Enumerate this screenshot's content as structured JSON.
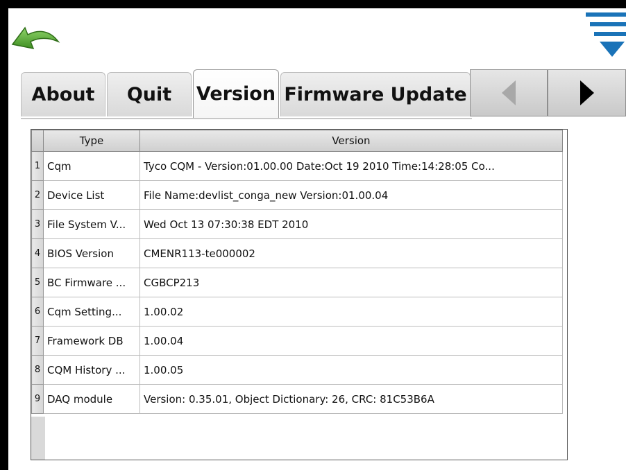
{
  "icons": {
    "back": "back-arrow-icon",
    "menu": "menu-triangle-icon",
    "prev": "left-triangle-icon",
    "next": "right-triangle-icon"
  },
  "colors": {
    "back_arrow": "#5aa832",
    "menu_blue": "#1a73b8",
    "frame": "#000000"
  },
  "tabs": [
    {
      "label": "About"
    },
    {
      "label": "Quit"
    },
    {
      "label": "Version",
      "active": true
    },
    {
      "label": "Firmware Update"
    }
  ],
  "table": {
    "columns": [
      "Type",
      "Version"
    ],
    "rows": [
      {
        "num": "1",
        "type": "Cqm",
        "version": "Tyco CQM -  Version:01.00.00 Date:Oct 19 2010  Time:14:28:05 Co..."
      },
      {
        "num": "2",
        "type": "Device List",
        "version": "File Name:devlist_conga_new Version:01.00.04"
      },
      {
        "num": "3",
        "type": "File System V...",
        "version": "Wed Oct 13 07:30:38 EDT 2010"
      },
      {
        "num": "4",
        "type": "BIOS Version",
        "version": "CMENR113-te000002"
      },
      {
        "num": "5",
        "type": "BC Firmware ...",
        "version": "CGBCP213"
      },
      {
        "num": "6",
        "type": "Cqm Setting...",
        "version": "1.00.02"
      },
      {
        "num": "7",
        "type": "Framework DB",
        "version": "1.00.04"
      },
      {
        "num": "8",
        "type": "CQM History ...",
        "version": "1.00.05"
      },
      {
        "num": "9",
        "type": "DAQ module",
        "version": "Version: 0.35.01, Object Dictionary: 26, CRC: 81C53B6A"
      }
    ]
  }
}
